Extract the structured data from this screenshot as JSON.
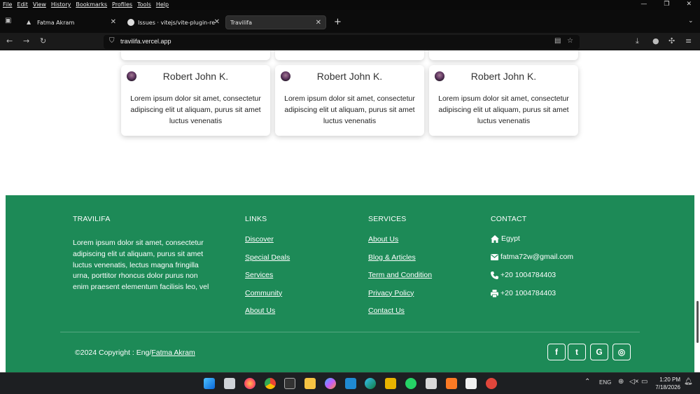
{
  "browser": {
    "menu": [
      "File",
      "Edit",
      "View",
      "History",
      "Bookmarks",
      "Profiles",
      "Tools",
      "Help"
    ],
    "tabs": [
      {
        "label": "Fatma Akram",
        "icon": "triangle-icon"
      },
      {
        "label": "Issues · vitejs/vite-plugin-react",
        "icon": "github-icon"
      },
      {
        "label": "Travilifa",
        "icon": "none"
      }
    ],
    "url": "travilifa.vercel.app"
  },
  "testimonials": [
    {
      "name": "Robert John K.",
      "text": "Lorem ipsum dolor sit amet, consectetur adipiscing elit ut aliquam, purus sit amet luctus venenatis"
    },
    {
      "name": "Robert John K.",
      "text": "Lorem ipsum dolor sit amet, consectetur adipiscing elit ut aliquam, purus sit amet luctus venenatis"
    },
    {
      "name": "Robert John K.",
      "text": "Lorem ipsum dolor sit amet, consectetur adipiscing elit ut aliquam, purus sit amet luctus venenatis"
    }
  ],
  "footer": {
    "brand": {
      "title": "TRAVILIFA",
      "text": "Lorem ipsum dolor sit amet, consectetur adipiscing elit ut aliquam, purus sit amet luctus venenatis, lectus magna fringilla urna, porttitor rhoncus dolor purus non enim praesent elementum facilisis leo, vel"
    },
    "links": {
      "title": "LINKS",
      "items": [
        "Discover",
        "Special Deals",
        "Services",
        "Community",
        "About Us"
      ]
    },
    "services": {
      "title": "SERVICES",
      "items": [
        "About Us",
        "Blog & Articles",
        "Term and Condition",
        "Privacy Policy",
        "Contact Us"
      ]
    },
    "contact": {
      "title": "CONTACT",
      "items": [
        {
          "icon": "home-icon",
          "text": "Egypt"
        },
        {
          "icon": "mail-icon",
          "text": "fatma72w@gmail.com"
        },
        {
          "icon": "phone-icon",
          "text": "+20 1004784403"
        },
        {
          "icon": "printer-icon",
          "text": "+20 1004784403"
        }
      ]
    },
    "copyright_prefix": "©2024 Copyright : Eng/",
    "copyright_name": "Fatma Akram",
    "social": [
      {
        "icon": "facebook-icon",
        "glyph": "f"
      },
      {
        "icon": "twitter-icon",
        "glyph": "t"
      },
      {
        "icon": "google-icon",
        "glyph": "G"
      },
      {
        "icon": "instagram-icon",
        "glyph": "◎"
      }
    ]
  },
  "taskbar": {
    "lang": "ENG",
    "time": "1:20 PM",
    "date": "7/18/2026"
  },
  "colors": {
    "footer_bg": "#1d8a57"
  }
}
